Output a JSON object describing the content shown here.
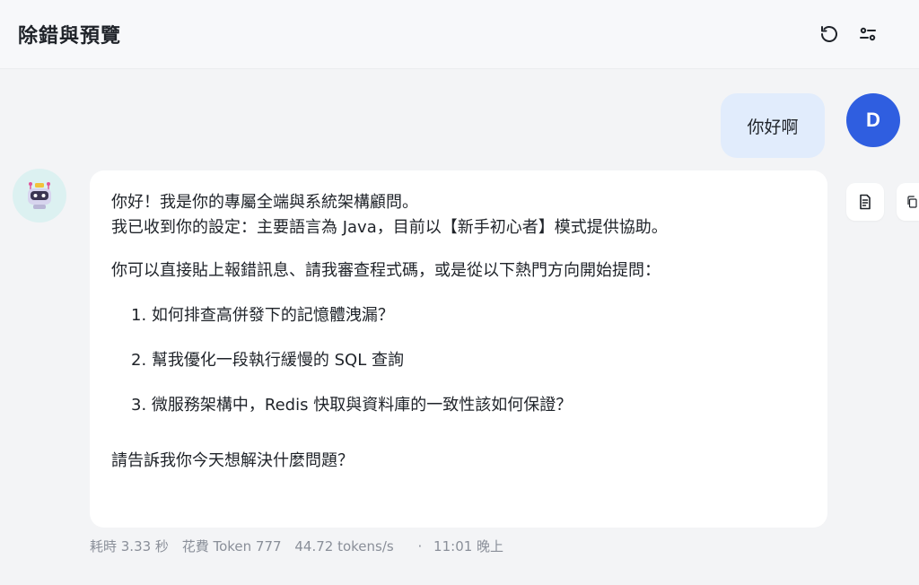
{
  "header": {
    "title": "除錯與預覽",
    "refresh_icon": "refresh-icon",
    "settings_icon": "sliders-icon"
  },
  "user_message": {
    "avatar_letter": "D",
    "text": "你好啊"
  },
  "assistant_message": {
    "avatar_icon": "robot-icon",
    "line1": "你好！我是你的專屬全端與系統架構顧問。",
    "line2": "我已收到你的設定：主要語言為 Java，目前以【新手初心者】模式提供協助。",
    "line3": "你可以直接貼上報錯訊息、請我審查程式碼，或是從以下熱門方向開始提問：",
    "items": [
      "1. 如何排查高併發下的記憶體洩漏？",
      "2. 幫我優化一段執行緩慢的 SQL 查詢",
      "3. 微服務架構中，Redis 快取與資料庫的一致性該如何保證？"
    ],
    "closing": "請告訴我你今天想解決什麼問題？"
  },
  "meta": {
    "time": "耗時 3.33 秒",
    "tokens": "花費 Token 777",
    "speed": "44.72 tokens/s",
    "separator": "·",
    "timestamp": "11:01 晚上"
  },
  "colors": {
    "accent": "#2f5ee0",
    "user_bubble": "#e1ecfc",
    "background": "#f3f4f6"
  }
}
